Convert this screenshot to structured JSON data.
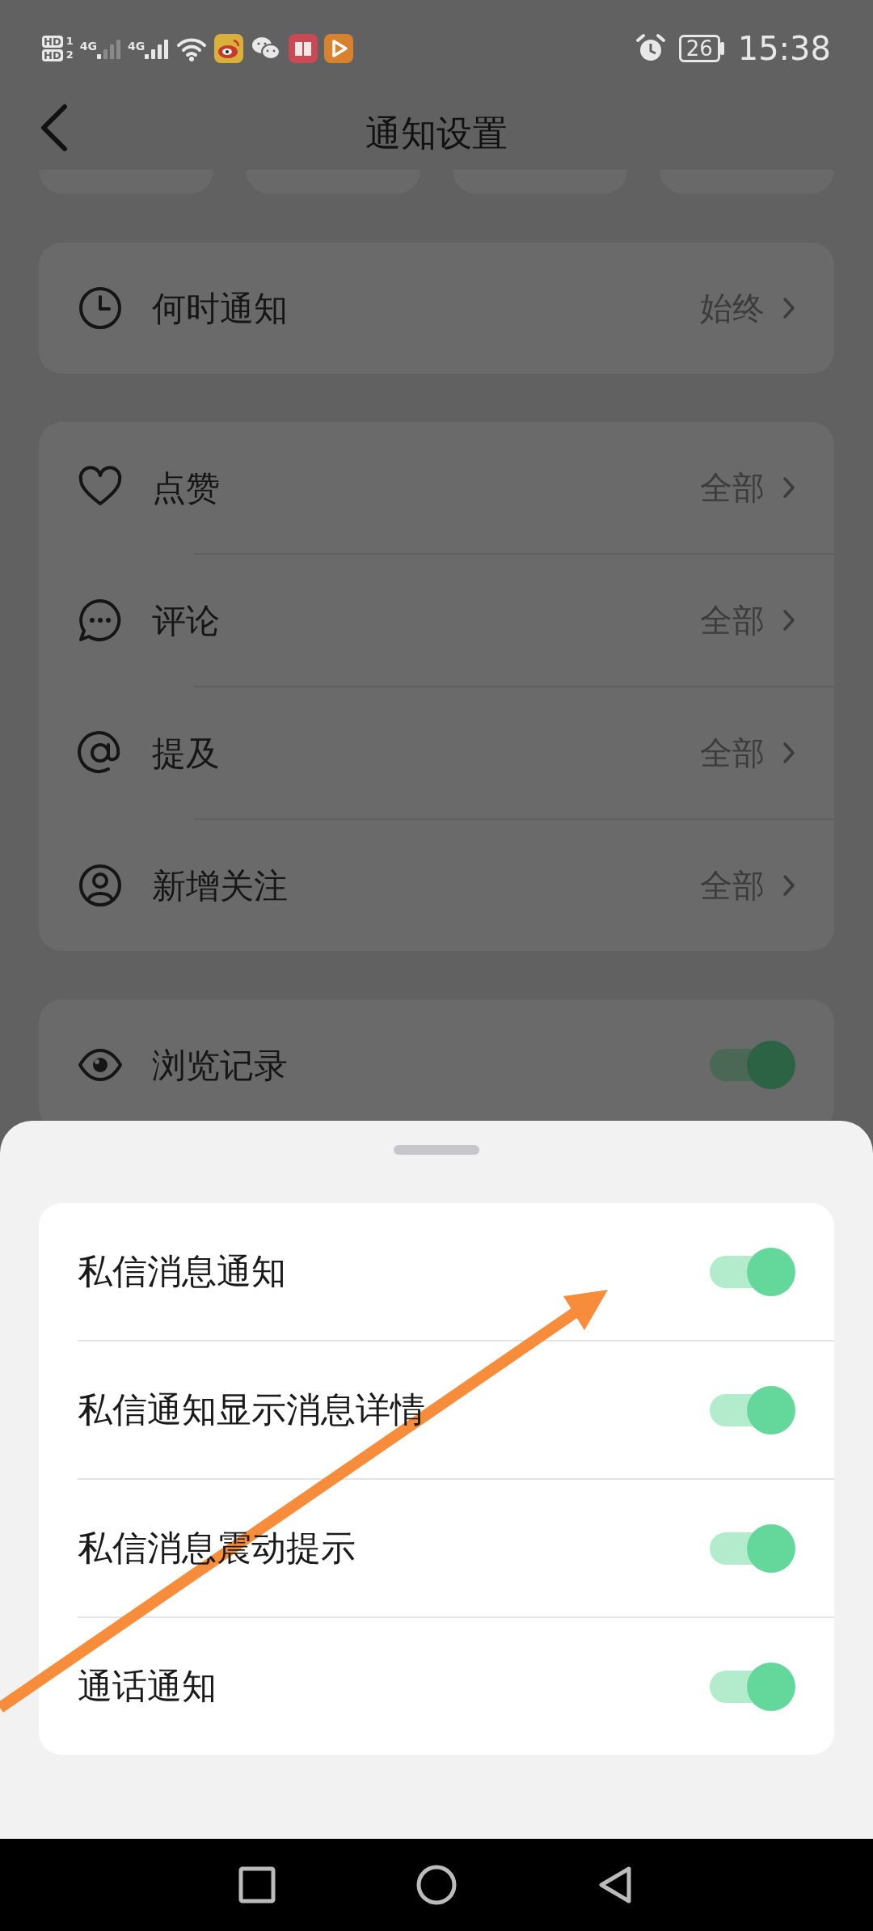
{
  "status_bar": {
    "sims": [
      {
        "badge": "HD",
        "slot": "1"
      },
      {
        "badge": "HD",
        "slot": "2"
      }
    ],
    "networks": [
      "4G",
      "4G"
    ],
    "battery": "26",
    "time": "15:38"
  },
  "header": {
    "title": "通知设置"
  },
  "sections": [
    {
      "rows": [
        {
          "kind": "link",
          "label": "何时通知",
          "value": "始终"
        }
      ]
    },
    {
      "rows": [
        {
          "kind": "link",
          "label": "点赞",
          "value": "全部"
        },
        {
          "kind": "link",
          "label": "评论",
          "value": "全部"
        },
        {
          "kind": "link",
          "label": "提及",
          "value": "全部"
        },
        {
          "kind": "link",
          "label": "新增关注",
          "value": "全部"
        }
      ]
    },
    {
      "rows": [
        {
          "kind": "switch",
          "label": "浏览记录",
          "on": true
        }
      ]
    }
  ],
  "sheet": {
    "rows": [
      {
        "label": "私信消息通知",
        "on": true
      },
      {
        "label": "私信通知显示消息详情",
        "on": true
      },
      {
        "label": "私信消息震动提示",
        "on": true
      },
      {
        "label": "通话通知",
        "on": true
      }
    ]
  }
}
